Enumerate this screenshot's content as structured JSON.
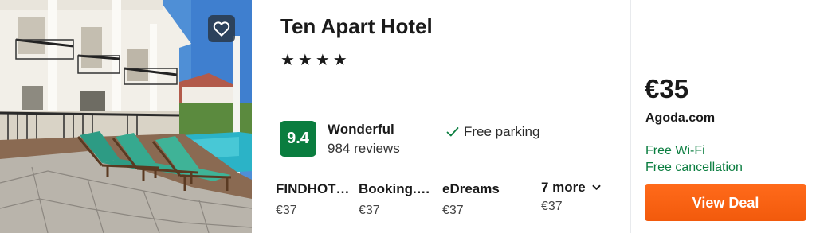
{
  "hotel": {
    "name": "Ten Apart Hotel",
    "stars": "★★★★",
    "star_count": 4
  },
  "rating": {
    "score": "9.4",
    "label": "Wonderful",
    "reviews": "984 reviews"
  },
  "amenities": [
    "Free parking"
  ],
  "providers": [
    {
      "name": "FINDHOT…",
      "price": "€37"
    },
    {
      "name": "Booking.…",
      "price": "€37"
    },
    {
      "name": "eDreams",
      "price": "€37"
    }
  ],
  "more": {
    "label": "7 more",
    "price": "€37"
  },
  "deal": {
    "price": "€35",
    "source": "Agoda.com",
    "perks": [
      "Free Wi-Fi",
      "Free cancellation"
    ],
    "button_label": "View Deal"
  },
  "icons": {
    "favorite": "heart-icon",
    "amenity_check": "check-icon",
    "more_toggle": "chevron-down-icon"
  },
  "colors": {
    "rating_badge": "#0a7d3f",
    "perk_text": "#0a7d3f",
    "deal_button": "#f25a0c"
  }
}
